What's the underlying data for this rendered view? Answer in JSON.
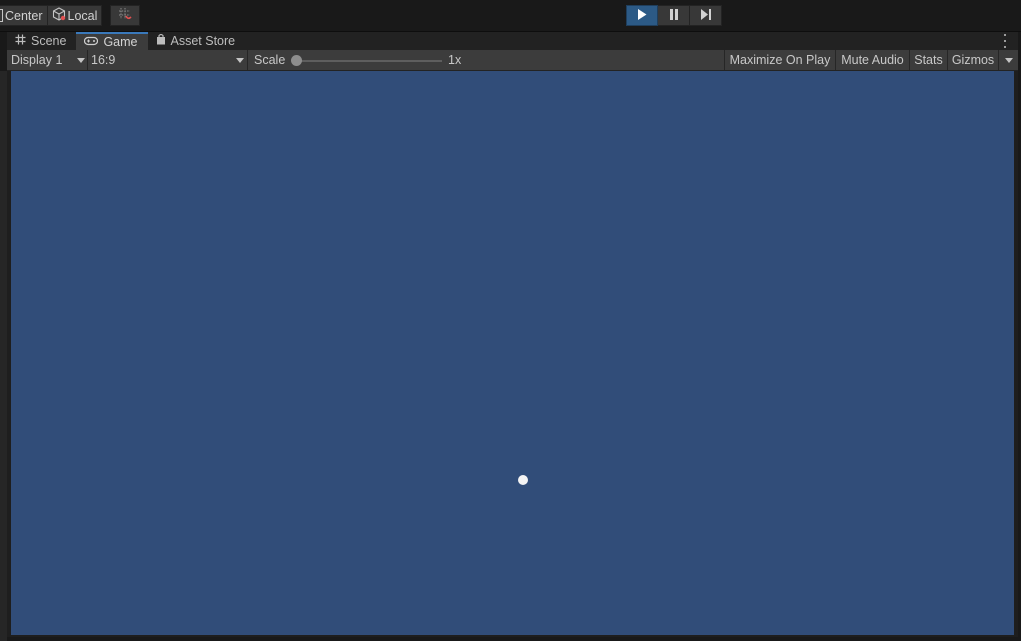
{
  "toolbar": {
    "pivot_label": "Center",
    "space_label": "Local",
    "snap_icon": "grid-snap-icon",
    "play_icon": "play-icon",
    "pause_icon": "pause-icon",
    "step_icon": "step-icon",
    "accent": "#2c5a86"
  },
  "tabs": [
    {
      "label": "Scene",
      "icon": "hash-grid-icon"
    },
    {
      "label": "Game",
      "icon": "gamepad-icon",
      "active": true
    },
    {
      "label": "Asset Store",
      "icon": "shopping-bag-icon"
    }
  ],
  "gamebar": {
    "display": "Display 1",
    "aspect": "16:9",
    "scale_label": "Scale",
    "scale_value": "1x",
    "scale_level": 0,
    "maximize_on_play": "Maximize On Play",
    "mute_audio": "Mute Audio",
    "stats": "Stats",
    "gizmos": "Gizmos"
  },
  "viewport": {
    "background": "#314d79",
    "object_color": "#f4f4f4"
  }
}
